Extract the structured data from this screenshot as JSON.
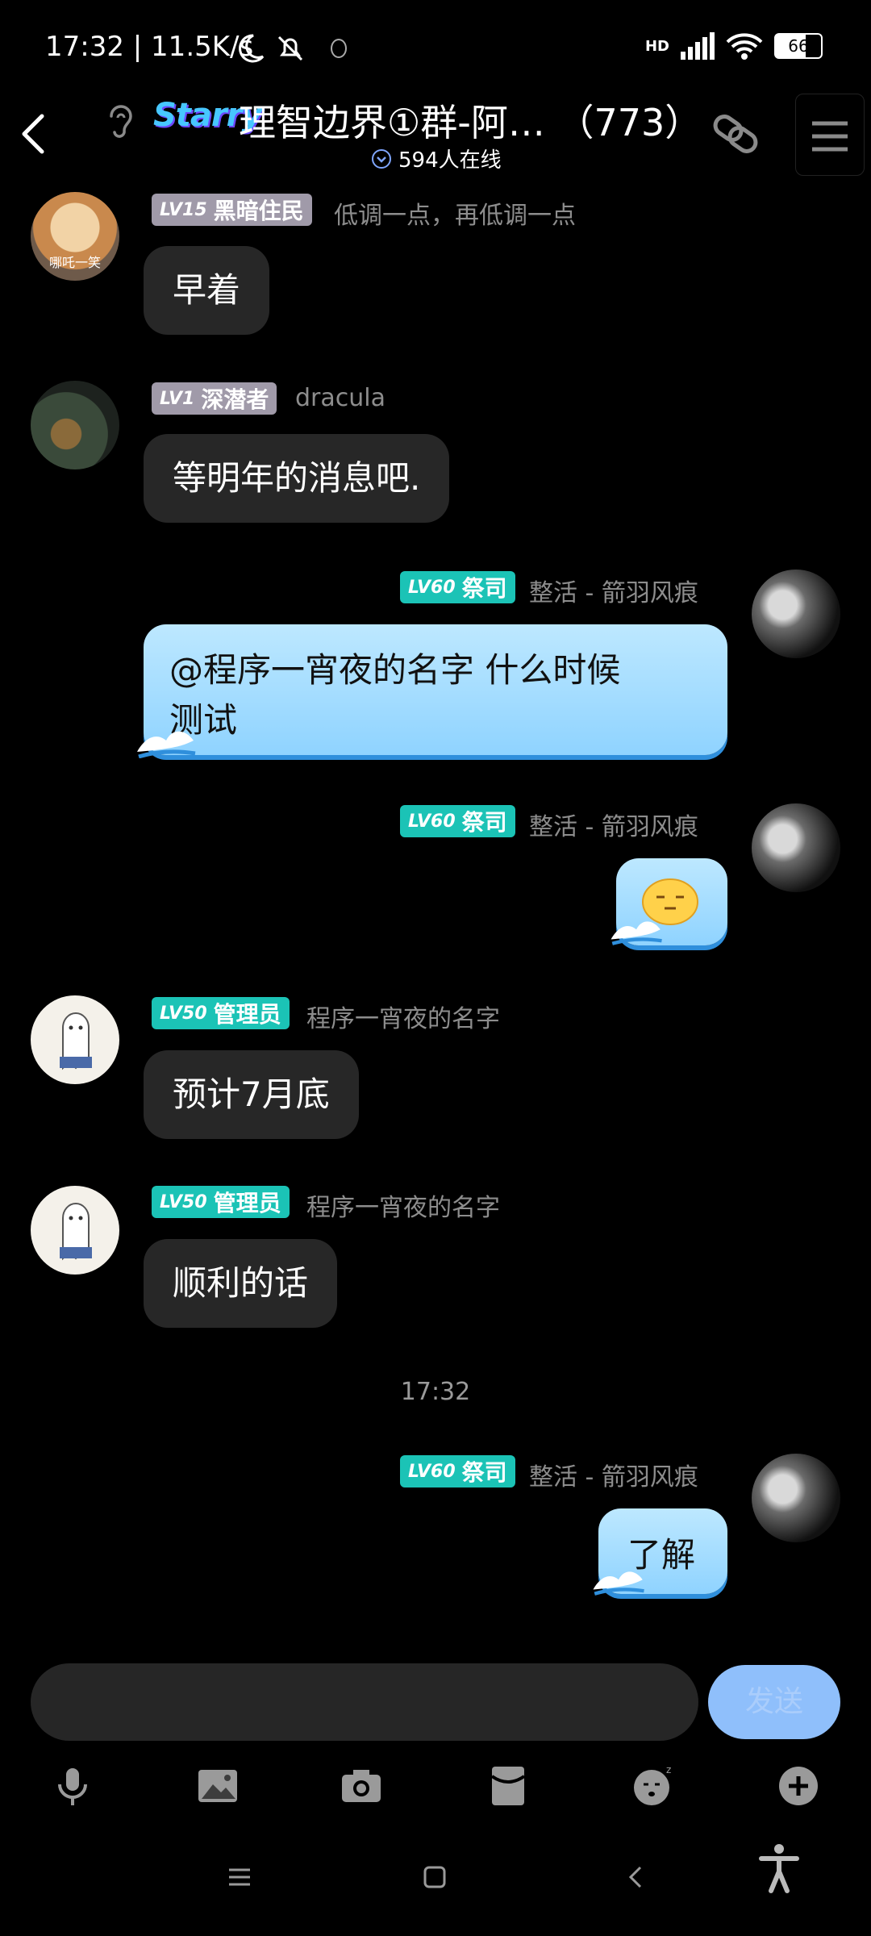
{
  "status_bar": {
    "time_speed": "17:32 | 11.5K/s",
    "network": "HD",
    "battery": "66"
  },
  "header": {
    "logo": "Starry",
    "title": "理智边界①群-阿…  （773）",
    "online": "594人在线"
  },
  "messages": [
    {
      "side": "left",
      "level": "LV15",
      "role": "黑暗住民",
      "name": "低调一点，再低调一点",
      "text": "早着",
      "avatar_caption": "哪吒一笑"
    },
    {
      "side": "left",
      "level": "LV1",
      "role": "深潜者",
      "name": "dracula",
      "text": "等明年的消息吧."
    },
    {
      "side": "right",
      "level": "LV60",
      "role": "祭司",
      "name": "整活 - 箭羽风痕",
      "text_line1": "@程序一宵夜的名字 什么时候",
      "text_line2": "测试"
    },
    {
      "side": "right",
      "level": "LV60",
      "role": "祭司",
      "name": "整活 - 箭羽风痕",
      "text": ""
    },
    {
      "side": "left",
      "level": "LV50",
      "role": "管理员",
      "name": "程序一宵夜的名字",
      "text": "预计7月底"
    },
    {
      "side": "left",
      "level": "LV50",
      "role": "管理员",
      "name": "程序一宵夜的名字",
      "text": "顺利的话"
    },
    {
      "side": "right",
      "level": "LV60",
      "role": "祭司",
      "name": "整活 - 箭羽风痕",
      "text": "了解"
    }
  ],
  "divider_time": "17:32",
  "composer": {
    "placeholder": "",
    "send_label": "发送"
  },
  "toolbar": [
    "microphone-icon",
    "image-icon",
    "camera-icon",
    "red-packet-icon",
    "sticker-icon",
    "plus-icon"
  ],
  "colors": {
    "badge_gray": "#a09aa9",
    "badge_teal": "#1bc3b6",
    "bubble_dark": "#272727",
    "bubble_blue": "#9fd9ff",
    "send_button": "#8fbffb"
  }
}
